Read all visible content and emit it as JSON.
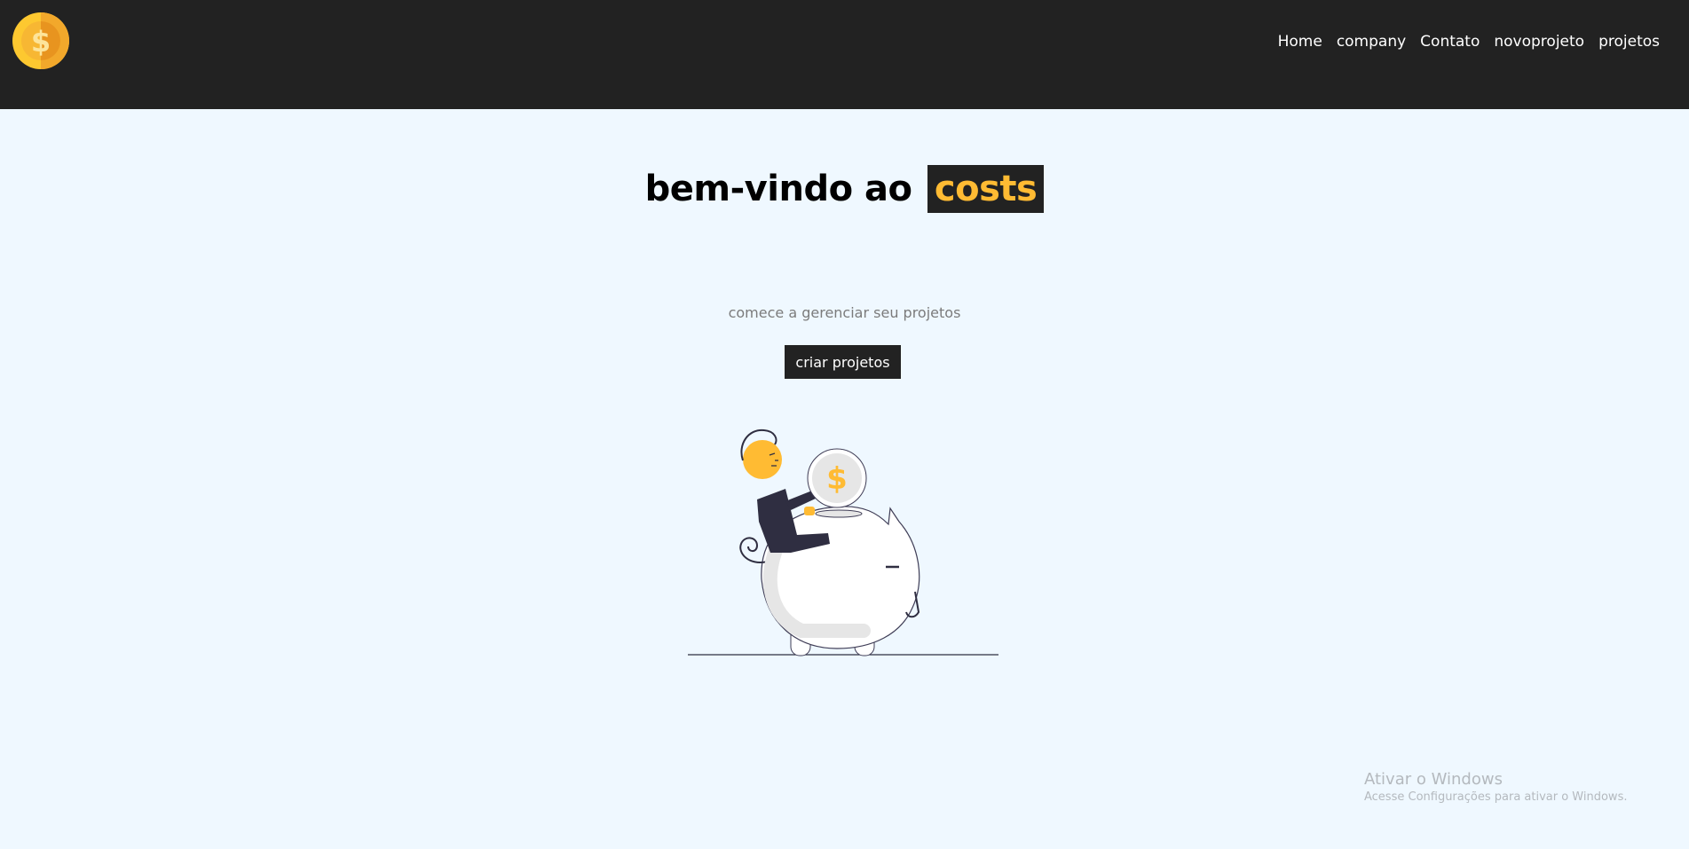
{
  "navbar": {
    "logo_icon": "dollar-coin-icon",
    "links": [
      {
        "label": "Home"
      },
      {
        "label": "company"
      },
      {
        "label": "Contato"
      },
      {
        "label": "novoprojeto"
      },
      {
        "label": "projetos"
      }
    ]
  },
  "hero": {
    "title_prefix": "bem-vindo ao",
    "title_brand": "costs",
    "subtitle": "comece a gerenciar seu projetos",
    "cta_label": "criar projetos",
    "illustration": "person-saving-coin-piggy-bank-illustration"
  },
  "watermark": {
    "title": "Ativar o Windows",
    "subtitle": "Acesse Configurações para ativar o Windows."
  },
  "colors": {
    "navbar_bg": "#222222",
    "page_bg": "#eff8ff",
    "accent": "#ffbb33"
  }
}
